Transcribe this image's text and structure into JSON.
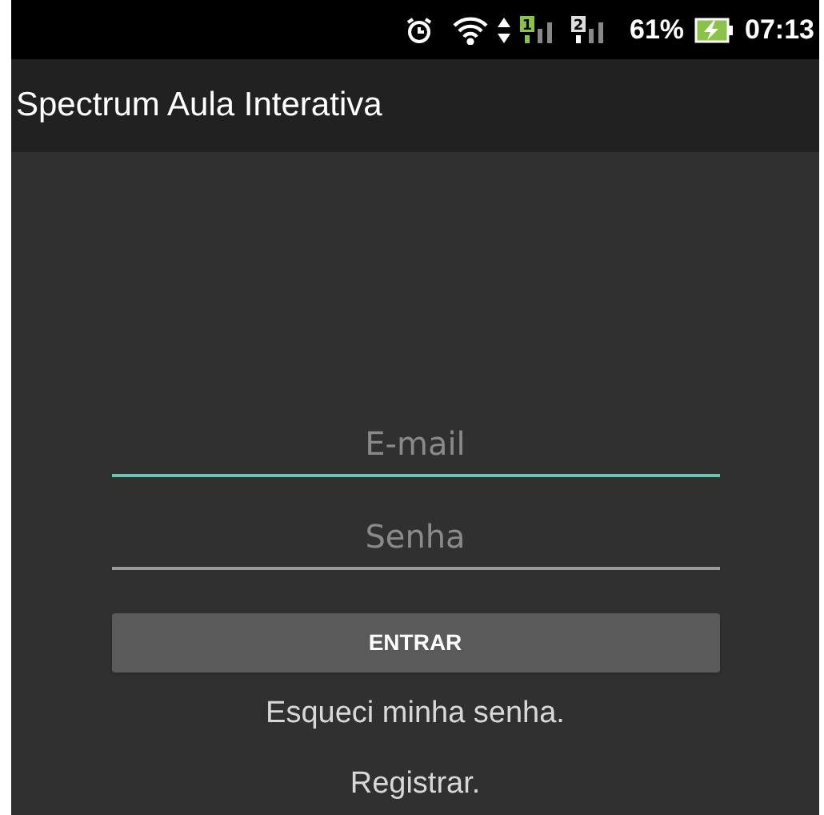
{
  "status_bar": {
    "sims": [
      {
        "label": "1",
        "active": true
      },
      {
        "label": "2",
        "active": false
      }
    ],
    "battery": "61%",
    "charging": true,
    "time": "07:13"
  },
  "app_bar": {
    "title": "Spectrum Aula Interativa"
  },
  "fields": [
    {
      "placeholder": "E-mail",
      "focused": true
    },
    {
      "placeholder": "Senha",
      "focused": false
    }
  ],
  "button": "ENTRAR",
  "links": [
    "Esqueci minha senha.",
    "Registrar."
  ]
}
